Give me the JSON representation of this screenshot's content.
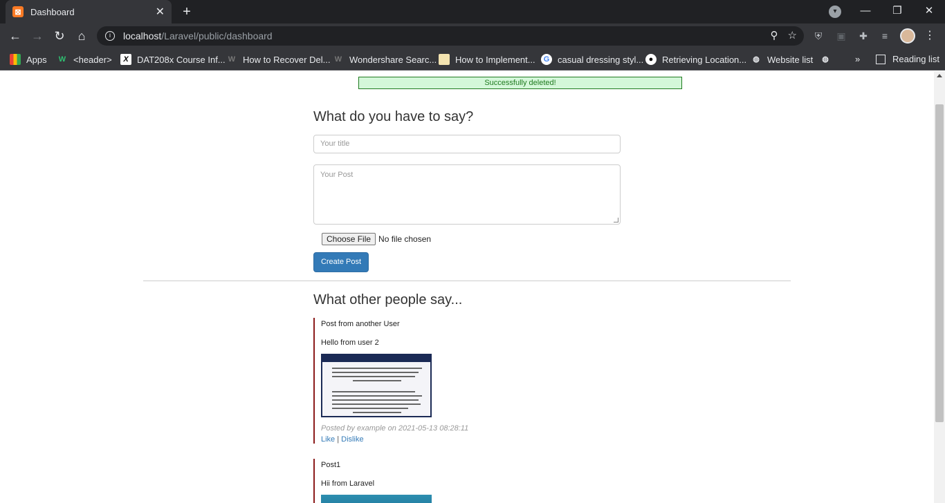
{
  "browser": {
    "tab_title": "Dashboard",
    "tab_favicon_letter": "⊠",
    "url_host": "localhost",
    "url_path": "/Laravel/public/dashboard",
    "bookmarks": [
      {
        "label": "Apps",
        "icon": "apps-grid-icon"
      },
      {
        "label": "<header>",
        "icon": "w-green-icon"
      },
      {
        "label": "DAT208x Course Inf...",
        "icon": "x-icon"
      },
      {
        "label": "How to Recover Del...",
        "icon": "wondershare-icon"
      },
      {
        "label": "Wondershare Searc...",
        "icon": "wondershare-icon"
      },
      {
        "label": "How to Implement...",
        "icon": "page-icon"
      },
      {
        "label": "casual dressing styl...",
        "icon": "google-icon"
      },
      {
        "label": "Retrieving Location...",
        "icon": "github-icon"
      },
      {
        "label": "Website list",
        "icon": "globe-icon"
      }
    ],
    "more_bookmarks": "»",
    "reading_list": "Reading list"
  },
  "page": {
    "alert": "Successfully deleted!",
    "form_heading": "What do you have to say?",
    "title_placeholder": "Your title",
    "post_placeholder": "Your Post",
    "choose_file": "Choose File",
    "no_file": "No file chosen",
    "create_button": "Create Post",
    "others_heading": "What other people say...",
    "posts": [
      {
        "title": "Post from another User",
        "body": "Hello from user 2",
        "meta": "Posted by example on 2021-05-13 08:28:11",
        "like": "Like",
        "sep": "|",
        "dislike": "Dislike"
      },
      {
        "title": "Post1",
        "body": "Hii from Laravel"
      }
    ]
  },
  "colors": {
    "accent": "#337ab7",
    "alert_bg": "#d4f7d9",
    "alert_text": "#1f7a1f",
    "post_border": "#8b1a1a"
  }
}
